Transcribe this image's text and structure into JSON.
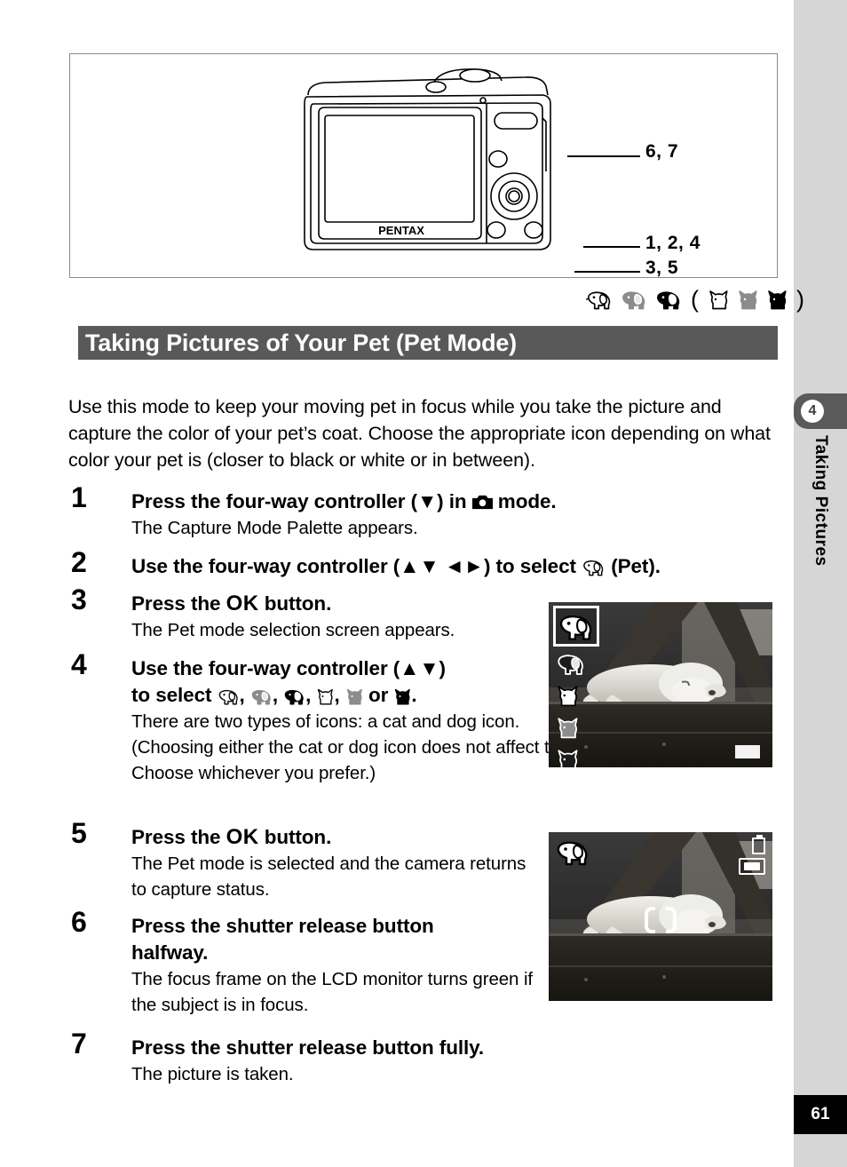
{
  "page": {
    "number": "61",
    "chapter_number": "4",
    "chapter_label": "Taking Pictures"
  },
  "illustration": {
    "camera_brand": "PENTAX",
    "callouts": [
      {
        "id": "shutter-callout",
        "text": "6, 7"
      },
      {
        "id": "four-way-callout",
        "text": "1, 2, 4"
      },
      {
        "id": "ok-callout",
        "text": "3, 5"
      }
    ]
  },
  "mode_icons": {
    "items": [
      {
        "name": "pet-dog-white-icon",
        "type": "dog",
        "shade": "white"
      },
      {
        "name": "pet-dog-gray-icon",
        "type": "dog",
        "shade": "gray"
      },
      {
        "name": "pet-dog-black-icon",
        "type": "dog",
        "shade": "black"
      },
      {
        "name": "pet-cat-white-icon",
        "type": "cat",
        "shade": "white"
      },
      {
        "name": "pet-cat-gray-icon",
        "type": "cat",
        "shade": "gray"
      },
      {
        "name": "pet-cat-black-icon",
        "type": "cat",
        "shade": "black"
      }
    ],
    "open_paren": "(",
    "close_paren": ")"
  },
  "section": {
    "title": "Taking Pictures of Your Pet (Pet Mode)",
    "intro": "Use this mode to keep your moving pet in focus while you take the picture and capture the color of your pet’s coat. Choose the appropriate icon depending on what color your pet is (closer to black or white or in between)."
  },
  "steps": [
    {
      "number": "1",
      "head_a": "Press the four-way controller (▼) in ",
      "head_b": " mode.",
      "body": "The Capture Mode Palette appears."
    },
    {
      "number": "2",
      "head_a": "Use the four-way controller (▲▼ ◄►) to select ",
      "head_b": " (Pet).",
      "body": ""
    },
    {
      "number": "3",
      "head_a": "Press the ",
      "ok": "OK",
      "head_b": " button.",
      "body": "The Pet mode selection screen appears."
    },
    {
      "number": "4",
      "head_a": "Use the four-way controller (▲▼)",
      "head_b": "to select ",
      "head_c": " or ",
      "head_d": ".",
      "body_1": "There are two types of icons: a cat and dog icon.",
      "body_2": "(Choosing either the cat or dog icon does not affect the resulting picture. Choose whichever you prefer.)"
    },
    {
      "number": "5",
      "head_a": "Press the ",
      "ok": "OK",
      "head_b": " button.",
      "body": "The Pet mode is selected and the camera returns to capture status."
    },
    {
      "number": "6",
      "head_a": "Press the shutter release button",
      "head_b": "halfway.",
      "body": "The focus frame on the LCD monitor turns green if the subject is in focus."
    },
    {
      "number": "7",
      "head_a": "Press the shutter release button fully.",
      "body": "The picture is taken."
    }
  ],
  "screenshots": [
    {
      "name": "pet-mode-selection-screen",
      "caption_subject": "sleeping dog photo",
      "selected_index": 0,
      "menu_icons": [
        "pet-dog-white-icon",
        "pet-dog-black-icon",
        "pet-cat-white-icon",
        "pet-cat-gray-icon",
        "pet-cat-black-icon"
      ]
    },
    {
      "name": "capture-status-screen",
      "caption_subject": "sleeping dog photo",
      "mode_icon": "pet-dog-white-icon",
      "osd_icons": [
        "battery-icon",
        "memory-card-icon",
        "focus-frame-icon"
      ]
    }
  ],
  "colors": {
    "title_bar_bg": "#595959",
    "sidebar_bg": "#d6d6d6",
    "chapter_tab_bg": "#5a5a5a",
    "page_box_bg": "#000000",
    "icon_gray": "#8c8c8c",
    "icon_black": "#000000"
  }
}
